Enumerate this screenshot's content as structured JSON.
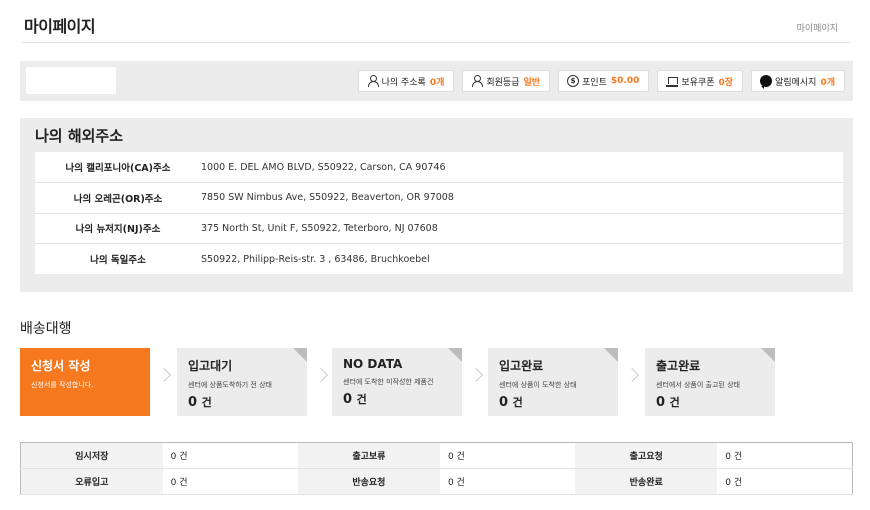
{
  "page": {
    "title": "마이페이지",
    "breadcrumb": "마이페이지"
  },
  "summary": {
    "items": [
      {
        "icon": "user-icon",
        "label": "나의 주소록",
        "value": "0개"
      },
      {
        "icon": "user-grade-icon",
        "label": "회원등급",
        "value": "일반"
      },
      {
        "icon": "coin-icon",
        "label": "포인트",
        "value": "$0.00"
      },
      {
        "icon": "coupon-icon",
        "label": "보유쿠폰",
        "value": "0장"
      },
      {
        "icon": "chat-icon",
        "label": "알림메시지",
        "value": "0개"
      }
    ]
  },
  "address": {
    "title": "나의 해외주소",
    "rows": [
      {
        "label": "나의 캘리포니아(CA)주소",
        "value": "1000 E. DEL AMO BLVD, S50922, Carson, CA   90746"
      },
      {
        "label": "나의 오레곤(OR)주소",
        "value": "7850 SW Nimbus Ave, S50922, Beaverton, OR   97008"
      },
      {
        "label": "나의 뉴저지(NJ)주소",
        "value": "375 North St, Unit F, S50922, Teterboro, NJ   07608"
      },
      {
        "label": "나의 독일주소",
        "value": "S50922, Philipp-Reis-str. 3 , 63486, Bruchkoebel"
      }
    ]
  },
  "shipping": {
    "title": "배송대행",
    "steps": [
      {
        "title": "신청서 작성",
        "desc": "신청서를 작성합니다.",
        "count": ""
      },
      {
        "title": "입고대기",
        "desc": "센터에 상품도착하기 전 상태",
        "count": "0",
        "unit": "건"
      },
      {
        "title": "NO DATA",
        "desc": "센터에 도착한 미작성한 제품건",
        "count": "0",
        "unit": "건"
      },
      {
        "title": "입고완료",
        "desc": "센터에 상품이 도착한 상태",
        "count": "0",
        "unit": "건"
      },
      {
        "title": "출고완료",
        "desc": "센터에서 상품이 출고된 상태",
        "count": "0",
        "unit": "건"
      }
    ],
    "status": [
      [
        {
          "label": "임시저장",
          "value": "0 건"
        },
        {
          "label": "출고보류",
          "value": "0 건"
        },
        {
          "label": "출고요청",
          "value": "0 건"
        }
      ],
      [
        {
          "label": "오류입고",
          "value": "0 건"
        },
        {
          "label": "반송요청",
          "value": "0 건"
        },
        {
          "label": "반송완료",
          "value": "0 건"
        }
      ]
    ]
  }
}
